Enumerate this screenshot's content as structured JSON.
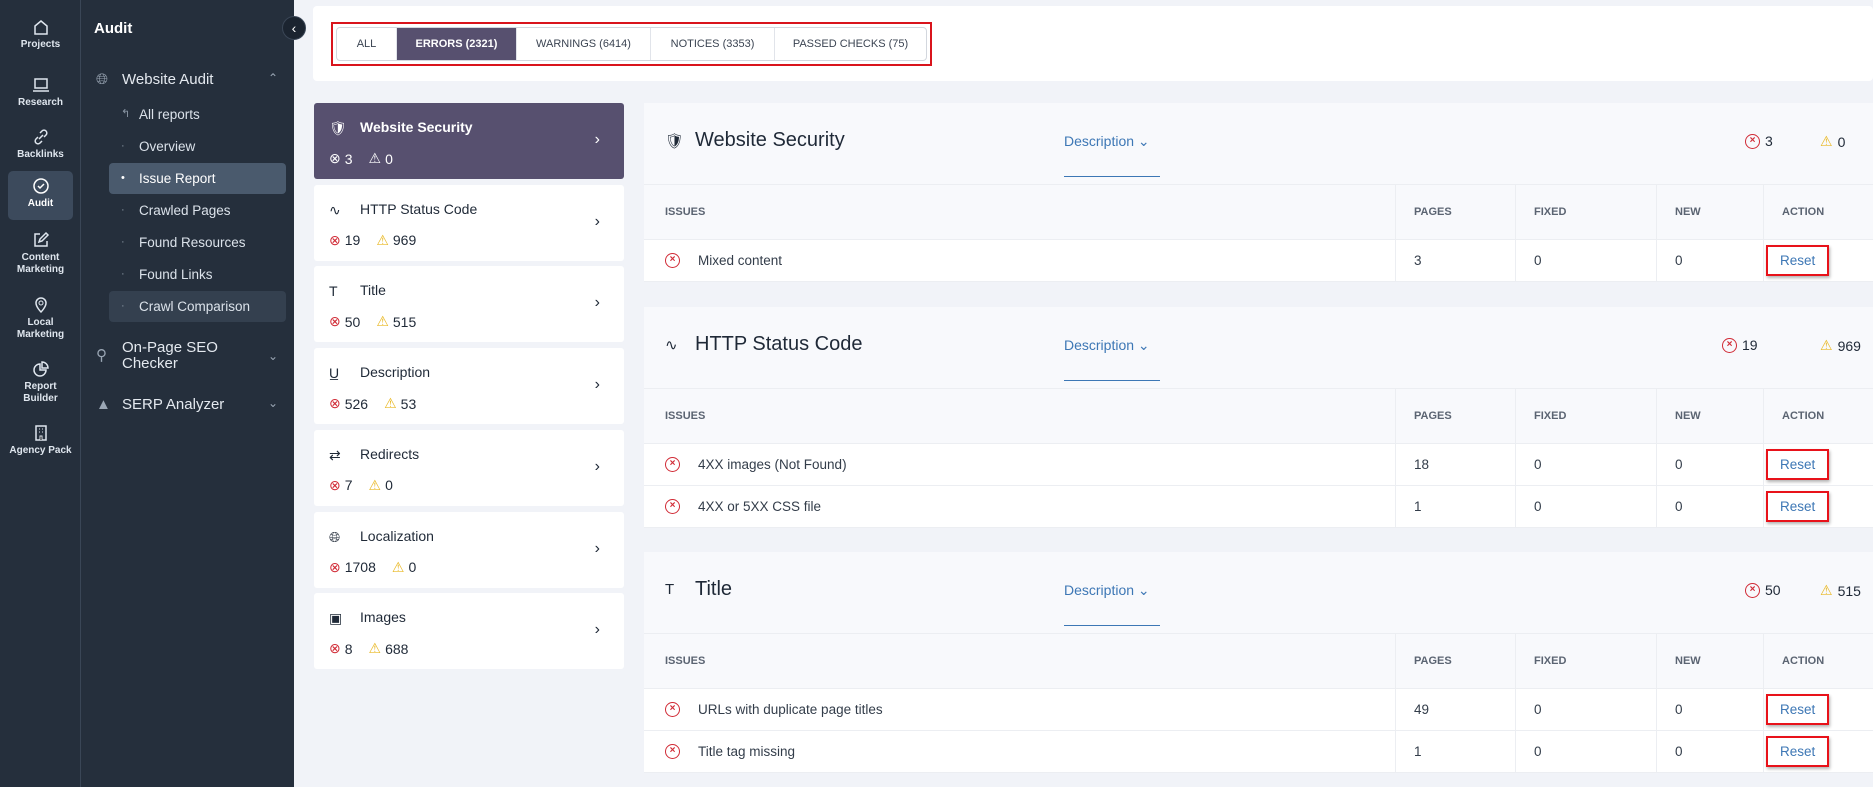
{
  "rail": [
    {
      "label": "Projects"
    },
    {
      "label": "Research"
    },
    {
      "label": "Backlinks"
    },
    {
      "label": "Audit"
    },
    {
      "label": "Content Marketing"
    },
    {
      "label": "Local Marketing"
    },
    {
      "label": "Report Builder"
    },
    {
      "label": "Agency Pack"
    }
  ],
  "sidebar": {
    "title": "Audit",
    "website_audit": "Website Audit",
    "items": [
      "All reports",
      "Overview",
      "Issue Report",
      "Crawled Pages",
      "Found Resources",
      "Found Links",
      "Crawl Comparison"
    ],
    "onpage": "On-Page SEO Checker",
    "serp": "SERP Analyzer"
  },
  "tabs": [
    "ALL",
    "ERRORS (2321)",
    "WARNINGS (6414)",
    "NOTICES (3353)",
    "PASSED CHECKS (75)"
  ],
  "categories": [
    {
      "name": "Website Security",
      "errors": "3",
      "warnings": "0"
    },
    {
      "name": "HTTP Status Code",
      "errors": "19",
      "warnings": "969"
    },
    {
      "name": "Title",
      "errors": "50",
      "warnings": "515"
    },
    {
      "name": "Description",
      "errors": "526",
      "warnings": "53"
    },
    {
      "name": "Redirects",
      "errors": "7",
      "warnings": "0"
    },
    {
      "name": "Localization",
      "errors": "1708",
      "warnings": "0"
    },
    {
      "name": "Images",
      "errors": "8",
      "warnings": "688"
    }
  ],
  "columns": [
    "ISSUES",
    "PAGES",
    "FIXED",
    "NEW",
    "ACTION"
  ],
  "description_label": "Description",
  "panels": [
    {
      "title": "Website Security",
      "errors": "3",
      "warnings": "0",
      "rows": [
        {
          "issue": "Mixed content",
          "pages": "3",
          "fixed": "0",
          "new": "0",
          "action": "Reset"
        }
      ]
    },
    {
      "title": "HTTP Status Code",
      "errors": "19",
      "warnings": "969",
      "rows": [
        {
          "issue": "4XX images (Not Found)",
          "pages": "18",
          "fixed": "0",
          "new": "0",
          "action": "Reset"
        },
        {
          "issue": "4XX or 5XX CSS file",
          "pages": "1",
          "fixed": "0",
          "new": "0",
          "action": "Reset"
        }
      ]
    },
    {
      "title": "Title",
      "errors": "50",
      "warnings": "515",
      "rows": [
        {
          "issue": "URLs with duplicate page titles",
          "pages": "49",
          "fixed": "0",
          "new": "0",
          "action": "Reset"
        },
        {
          "issue": "Title tag missing",
          "pages": "1",
          "fixed": "0",
          "new": "0",
          "action": "Reset"
        }
      ]
    }
  ]
}
